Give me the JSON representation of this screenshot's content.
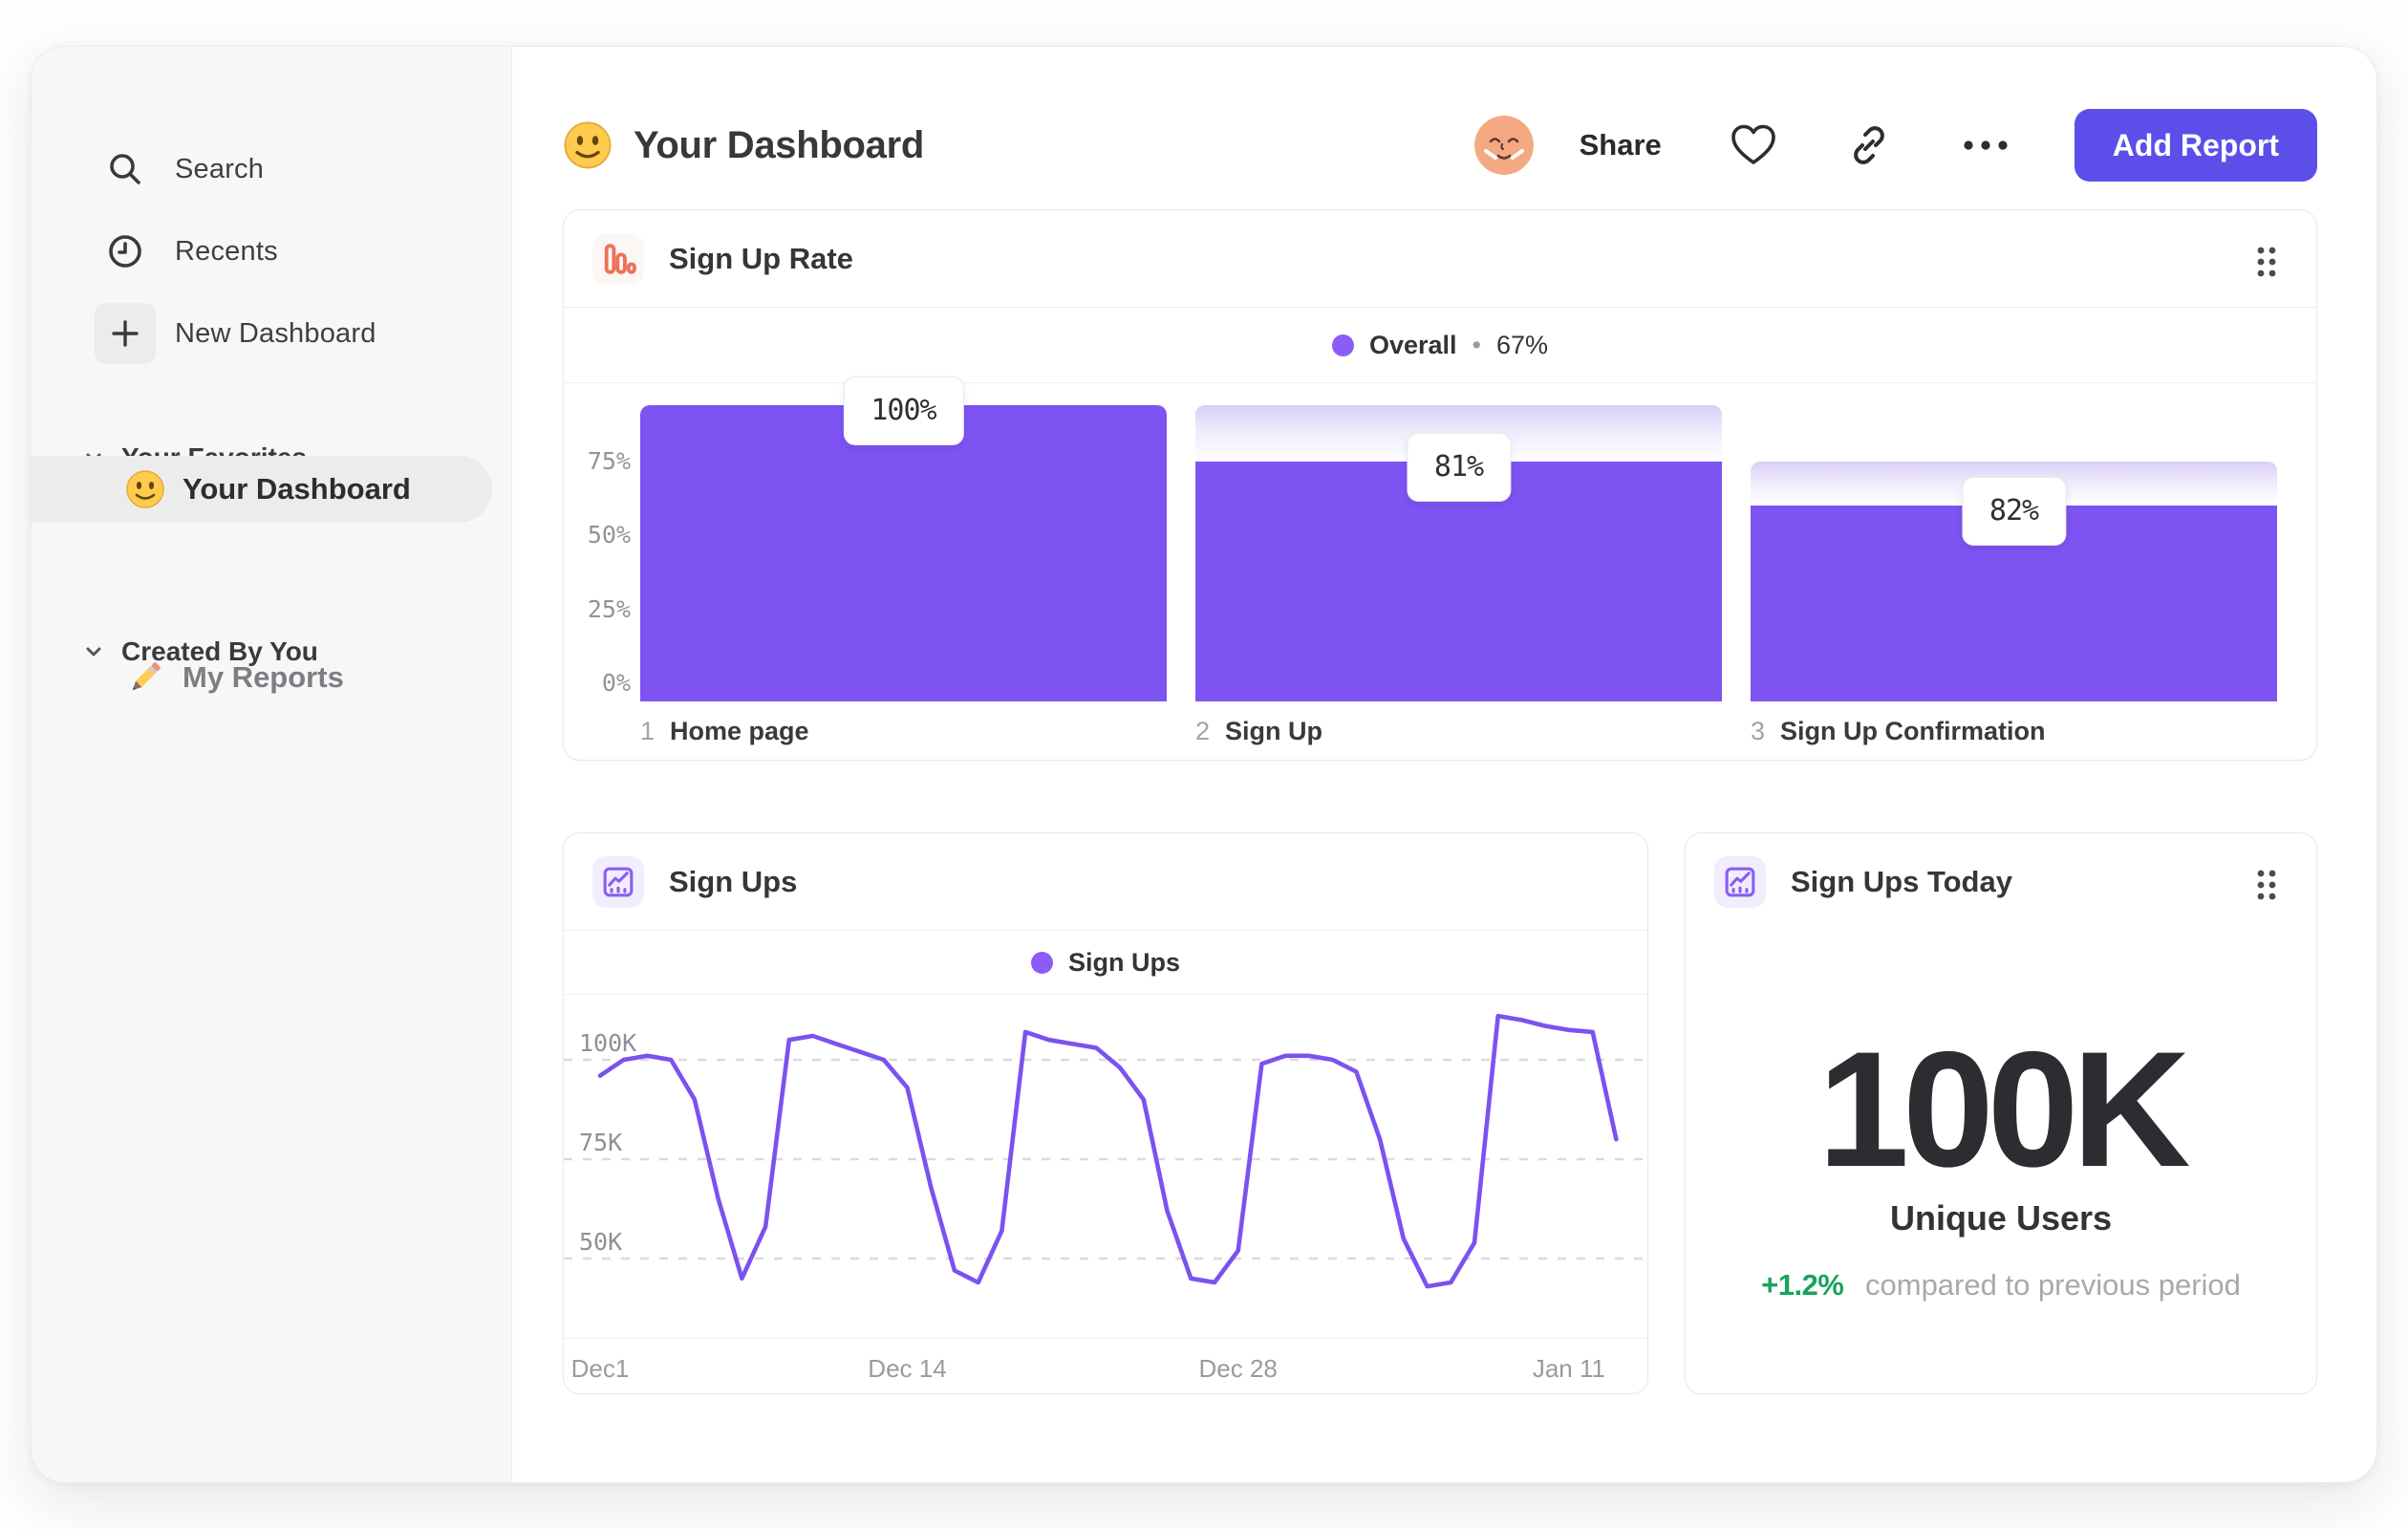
{
  "colors": {
    "bar_purple": "#7d53f2",
    "bar_gradient_top": "#d8cef7",
    "line_purple": "#7b52f0",
    "legend_dot_purple": "#8c5cf6",
    "button_purple": "#5c4fe9",
    "icon_orange": "#ee7156",
    "icon_purple": "#8a5cf5",
    "delta_green": "#17a45b"
  },
  "sidebar": {
    "nav": [
      {
        "icon": "search-icon",
        "label": "Search"
      },
      {
        "icon": "clock-icon",
        "label": "Recents"
      },
      {
        "icon": "plus-icon",
        "label": "New Dashboard"
      }
    ],
    "sections": [
      {
        "label": "Your Favorites",
        "items": [
          {
            "icon": "smiley-emoji",
            "label": "Your Dashboard",
            "active": true
          }
        ]
      },
      {
        "label": "Created By You",
        "items": [
          {
            "icon": "pencil-emoji",
            "label": "My Reports",
            "active": false
          }
        ]
      }
    ]
  },
  "header": {
    "title_emoji": "slightly-smiling-face",
    "title": "Your Dashboard",
    "share_label": "Share",
    "add_report_label": "Add Report"
  },
  "chart_data": [
    {
      "type": "bar",
      "variant": "funnel",
      "title": "Sign Up Rate",
      "legend": {
        "label": "Overall",
        "separator": "•",
        "value": "67%"
      },
      "step_numbers": [
        "1",
        "2",
        "3"
      ],
      "categories": [
        "Home page",
        "Sign Up",
        "Sign Up Confirmation"
      ],
      "values": [
        100,
        81,
        82
      ],
      "value_labels": [
        "100%",
        "81%",
        "82%"
      ],
      "cumulative_percent": [
        100,
        81,
        66
      ],
      "yticks": [
        "0%",
        "25%",
        "50%",
        "75%"
      ],
      "ylim": [
        0,
        100
      ],
      "legend_position": "top-center",
      "grid": false
    },
    {
      "type": "line",
      "title": "Sign Ups",
      "legend": {
        "label": "Sign Ups"
      },
      "x_unit": "days since Dec 1",
      "xticks": [
        {
          "label": "Dec1",
          "day": 0
        },
        {
          "label": "Dec 14",
          "day": 13
        },
        {
          "label": "Dec 28",
          "day": 27
        },
        {
          "label": "Jan 11",
          "day": 41
        }
      ],
      "yticks": [
        {
          "label": "50K",
          "value": 50
        },
        {
          "label": "75K",
          "value": 75
        },
        {
          "label": "100K",
          "value": 100
        }
      ],
      "ylim": [
        36,
        116
      ],
      "grid": "dashed-horizontal",
      "legend_position": "top-center",
      "series": [
        {
          "name": "Sign Ups",
          "values": [
            96,
            100,
            101,
            100,
            90,
            65,
            45,
            58,
            105,
            106,
            104,
            102,
            100,
            93,
            68,
            47,
            44,
            57,
            107,
            105,
            104,
            103,
            98,
            90,
            62,
            45,
            44,
            52,
            99,
            101,
            101,
            100,
            97,
            80,
            55,
            43,
            44,
            54,
            111,
            110,
            108.5,
            107.5,
            107,
            80
          ]
        }
      ]
    },
    {
      "type": "kpi",
      "title": "Sign Ups Today",
      "value": "100K",
      "value_label": "Unique Users",
      "delta": "+1.2%",
      "delta_description": "compared to previous period"
    }
  ]
}
